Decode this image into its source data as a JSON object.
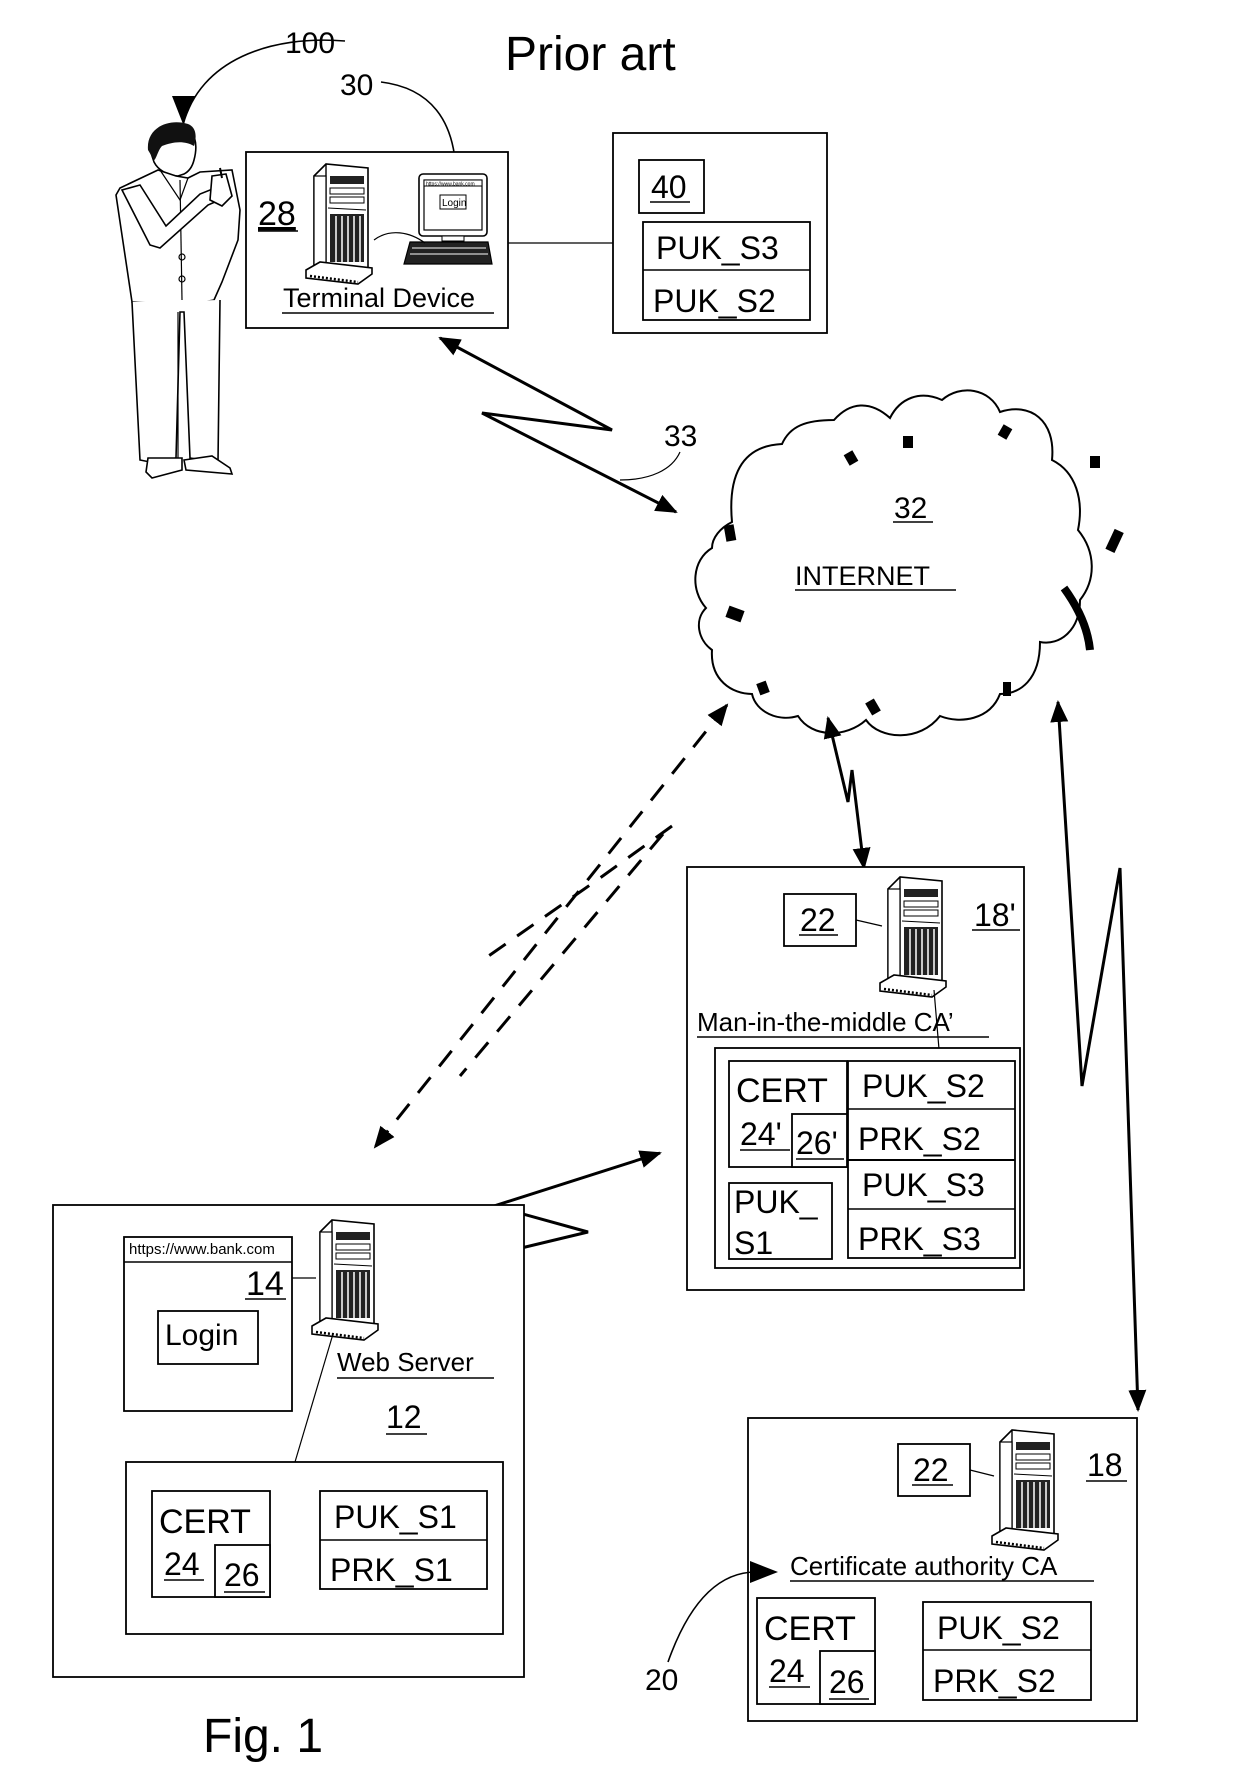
{
  "figure": {
    "heading": "Prior art",
    "caption": "Fig. 1"
  },
  "reference_labels": {
    "user": "100",
    "browser_pointer": "30",
    "wireless_link": "33",
    "ca_pointer": "20"
  },
  "terminal": {
    "ref": "28",
    "label": "Terminal Device",
    "screen_url": "https://www.bank.com",
    "screen_button": "Login"
  },
  "keystore": {
    "ref": "40",
    "rows": [
      "PUK_S3",
      "PUK_S2"
    ]
  },
  "internet": {
    "ref": "32",
    "label": "INTERNET"
  },
  "mitm": {
    "ref": "18'",
    "module_ref": "22",
    "label": "Man-in-the-middle CA’",
    "cert_label": "CERT",
    "cert_ref": "24'",
    "sig_ref": "26'",
    "puk_s1_line1": "PUK_",
    "puk_s1_line2": "S1",
    "keys": [
      "PUK_S2",
      "PRK_S2",
      "PUK_S3",
      "PRK_S3"
    ]
  },
  "web_server": {
    "ref": "12",
    "label": "Web Server",
    "page_url": "https://www.bank.com",
    "page_ref": "14",
    "login_button": "Login",
    "cert_label": "CERT",
    "cert_ref": "24",
    "sig_ref": "26",
    "keys": [
      "PUK_S1",
      "PRK_S1"
    ]
  },
  "ca": {
    "ref": "18",
    "module_ref": "22",
    "label": "Certificate authority CA",
    "cert_label": "CERT",
    "cert_ref": "24",
    "sig_ref": "26",
    "keys": [
      "PUK_S2",
      "PRK_S2"
    ]
  }
}
